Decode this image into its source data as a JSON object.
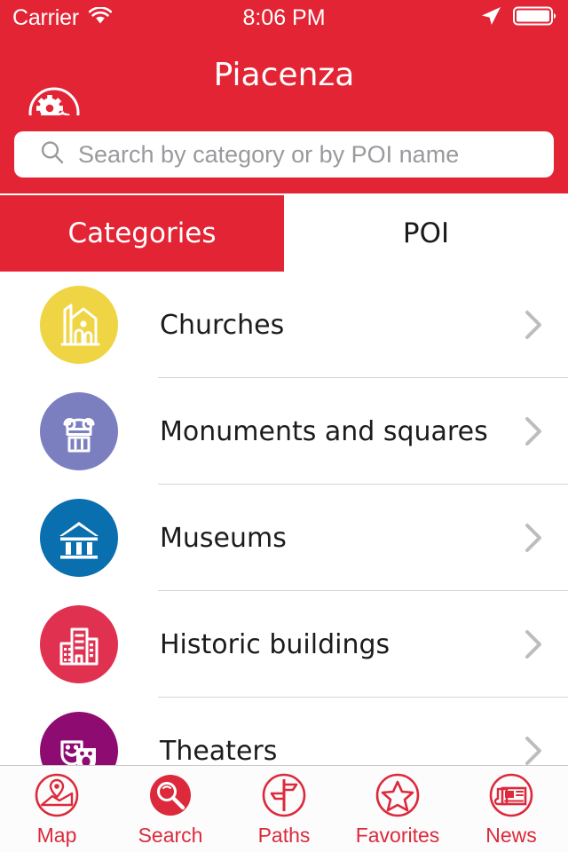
{
  "theme": {
    "brand_red": "#E32434",
    "tab_red": "#DC2A3C",
    "separator": "#d4d4d4"
  },
  "status_bar": {
    "carrier": "Carrier",
    "wifi_icon": "wifi-icon",
    "time": "8:06 PM",
    "location_icon": "location-arrow-icon",
    "battery_icon": "battery-full-icon"
  },
  "nav_bar": {
    "title": "Piacenza",
    "settings_icon": "gears-settings-icon"
  },
  "search": {
    "placeholder": "Search by category or by POI name",
    "value": "",
    "icon": "search-icon"
  },
  "segmented": {
    "tabs": [
      {
        "label": "Categories",
        "active": true
      },
      {
        "label": "POI",
        "active": false
      }
    ]
  },
  "categories": [
    {
      "label": "Churches",
      "icon": "church-icon",
      "color": "#EFD443",
      "chevron": "chevron-right-icon"
    },
    {
      "label": "Monuments and squares",
      "icon": "column-capital-icon",
      "color": "#7B7FC0",
      "chevron": "chevron-right-icon"
    },
    {
      "label": "Museums",
      "icon": "museum-icon",
      "color": "#0A6FAF",
      "chevron": "chevron-right-icon"
    },
    {
      "label": "Historic buildings",
      "icon": "buildings-icon",
      "color": "#E03150",
      "chevron": "chevron-right-icon"
    },
    {
      "label": "Theaters",
      "icon": "theater-masks-icon",
      "color": "#8E0C72",
      "chevron": "chevron-right-icon"
    }
  ],
  "tab_bar": {
    "items": [
      {
        "label": "Map",
        "icon": "map-pin-icon",
        "active": false
      },
      {
        "label": "Search",
        "icon": "search-icon",
        "active": true
      },
      {
        "label": "Paths",
        "icon": "signpost-icon",
        "active": false
      },
      {
        "label": "Favorites",
        "icon": "star-icon",
        "active": false
      },
      {
        "label": "News",
        "icon": "newspaper-icon",
        "active": false
      }
    ]
  }
}
